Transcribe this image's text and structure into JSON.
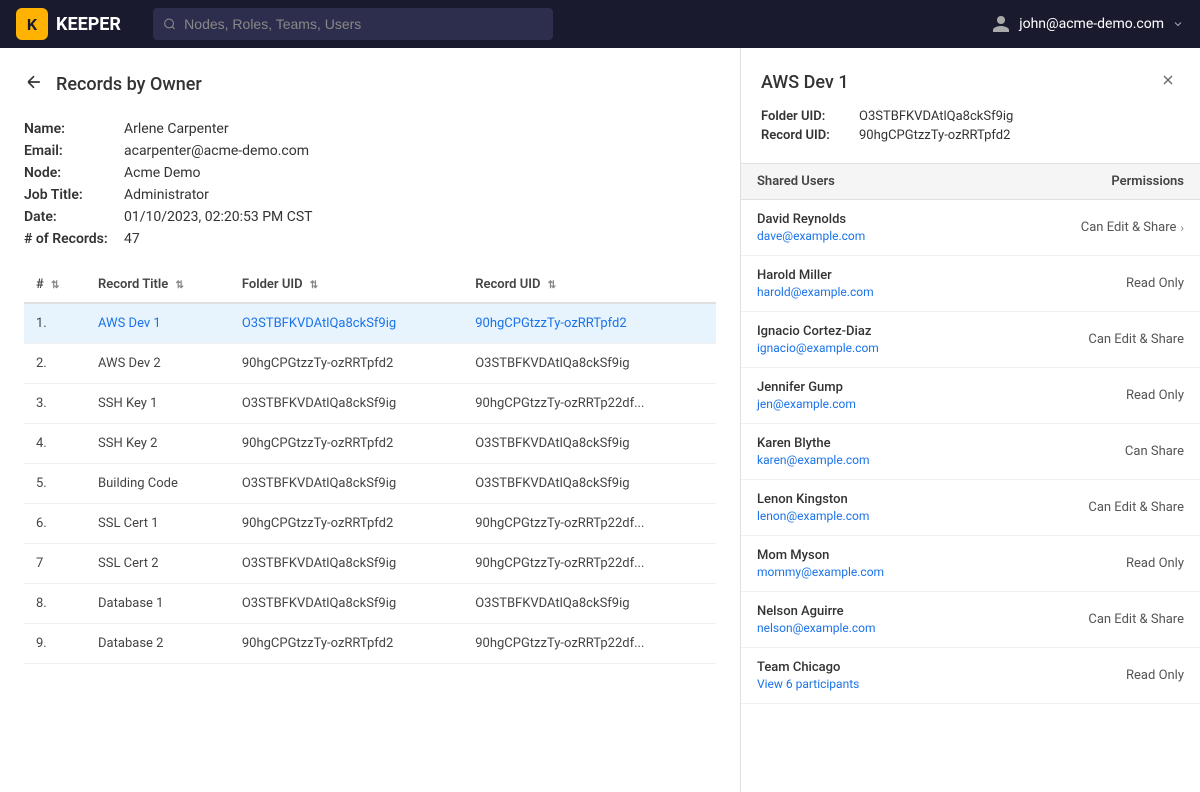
{
  "topnav": {
    "logo_text": "KEEPER",
    "search_placeholder": "Nodes, Roles, Teams, Users",
    "user_email": "john@acme-demo.com"
  },
  "page": {
    "title": "Records by Owner",
    "back_label": "←"
  },
  "owner_meta": {
    "name_label": "Name:",
    "name_value": "Arlene Carpenter",
    "email_label": "Email:",
    "email_value": "acarpenter@acme-demo.com",
    "node_label": "Node:",
    "node_value": "Acme Demo",
    "jobtitle_label": "Job Title:",
    "jobtitle_value": "Administrator",
    "date_label": "Date:",
    "date_value": "01/10/2023, 02:20:53 PM CST",
    "records_label": "# of Records:",
    "records_value": "47"
  },
  "table": {
    "columns": [
      {
        "id": "num",
        "label": "#",
        "sortable": true
      },
      {
        "id": "title",
        "label": "Record Title",
        "sortable": true
      },
      {
        "id": "folder_uid",
        "label": "Folder UID",
        "sortable": true
      },
      {
        "id": "record_uid",
        "label": "Record UID",
        "sortable": true
      }
    ],
    "rows": [
      {
        "num": "1.",
        "title": "AWS Dev 1",
        "folder_uid": "O3STBFKVDAtlQa8ckSf9ig",
        "record_uid": "90hgCPGtzzTy-ozRRTpfd2",
        "selected": true,
        "link": true
      },
      {
        "num": "2.",
        "title": "AWS Dev 2",
        "folder_uid": "90hgCPGtzzTy-ozRRTpfd2",
        "record_uid": "O3STBFKVDAtlQa8ckSf9ig",
        "selected": false,
        "link": false
      },
      {
        "num": "3.",
        "title": "SSH Key 1",
        "folder_uid": "O3STBFKVDAtlQa8ckSf9ig",
        "record_uid": "90hgCPGtzzTy-ozRRTp22df...",
        "selected": false,
        "link": false
      },
      {
        "num": "4.",
        "title": "SSH Key 2",
        "folder_uid": "90hgCPGtzzTy-ozRRTpfd2",
        "record_uid": "O3STBFKVDAtlQa8ckSf9ig",
        "selected": false,
        "link": false
      },
      {
        "num": "5.",
        "title": "Building Code",
        "folder_uid": "O3STBFKVDAtlQa8ckSf9ig",
        "record_uid": "O3STBFKVDAtlQa8ckSf9ig",
        "selected": false,
        "link": false
      },
      {
        "num": "6.",
        "title": "SSL Cert 1",
        "folder_uid": "90hgCPGtzzTy-ozRRTpfd2",
        "record_uid": "90hgCPGtzzTy-ozRRTp22df...",
        "selected": false,
        "link": false
      },
      {
        "num": "7",
        "title": "SSL Cert 2",
        "folder_uid": "O3STBFKVDAtlQa8ckSf9ig",
        "record_uid": "90hgCPGtzzTy-ozRRTp22df...",
        "selected": false,
        "link": false
      },
      {
        "num": "8.",
        "title": "Database 1",
        "folder_uid": "O3STBFKVDAtlQa8ckSf9ig",
        "record_uid": "O3STBFKVDAtlQa8ckSf9ig",
        "selected": false,
        "link": false
      },
      {
        "num": "9.",
        "title": "Database 2",
        "folder_uid": "90hgCPGtzzTy-ozRRTpfd2",
        "record_uid": "90hgCPGtzzTy-ozRRTp22df...",
        "selected": false,
        "link": false
      }
    ]
  },
  "detail_panel": {
    "title": "AWS Dev 1",
    "folder_uid_label": "Folder UID:",
    "folder_uid_value": "O3STBFKVDAtlQa8ckSf9ig",
    "record_uid_label": "Record UID:",
    "record_uid_value": "90hgCPGtzzTy-ozRRTpfd2",
    "shared_users_header": "Shared Users",
    "permissions_header": "Permissions",
    "shared_users": [
      {
        "name": "David Reynolds",
        "email": "dave@example.com",
        "permission": "Can Edit & Share",
        "has_arrow": true
      },
      {
        "name": "Harold Miller",
        "email": "harold@example.com",
        "permission": "Read Only",
        "has_arrow": false
      },
      {
        "name": "Ignacio Cortez-Diaz",
        "email": "ignacio@example.com",
        "permission": "Can Edit & Share",
        "has_arrow": false
      },
      {
        "name": "Jennifer Gump",
        "email": "jen@example.com",
        "permission": "Read Only",
        "has_arrow": false
      },
      {
        "name": "Karen Blythe",
        "email": "karen@example.com",
        "permission": "Can Share",
        "has_arrow": false
      },
      {
        "name": "Lenon Kingston",
        "email": "lenon@example.com",
        "permission": "Can Edit & Share",
        "has_arrow": false
      },
      {
        "name": "Mom Myson",
        "email": "mommy@example.com",
        "permission": "Read Only",
        "has_arrow": false
      },
      {
        "name": "Nelson Aguirre",
        "email": "nelson@example.com",
        "permission": "Can Edit & Share",
        "has_arrow": false
      },
      {
        "name": "Team Chicago",
        "email": "View 6 participants",
        "permission": "Read Only",
        "has_arrow": false,
        "is_team": true
      }
    ]
  }
}
